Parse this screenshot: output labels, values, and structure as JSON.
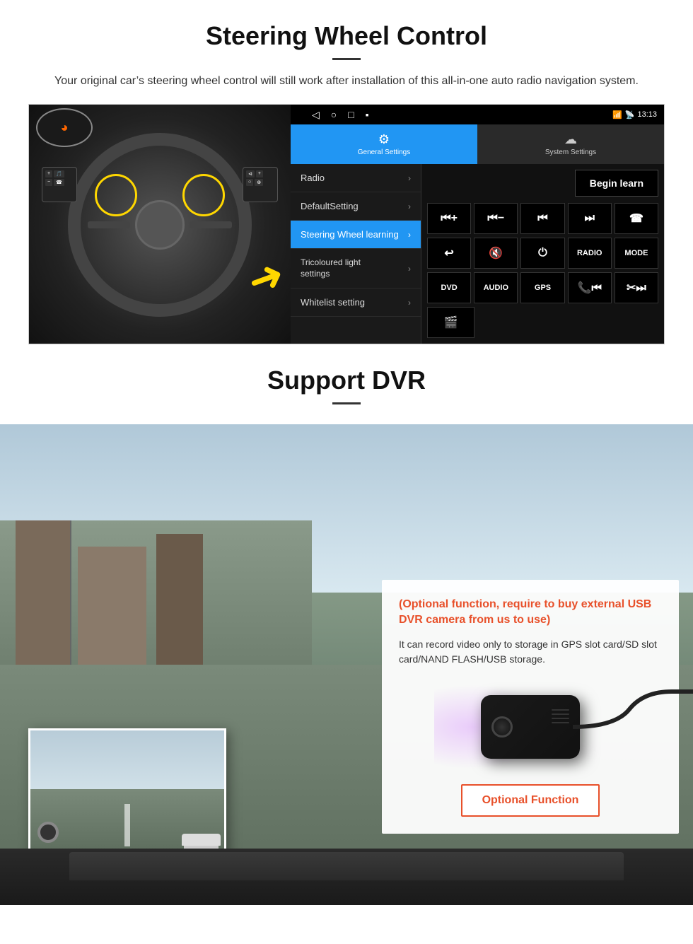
{
  "steering": {
    "title": "Steering Wheel Control",
    "subtitle": "Your original car’s steering wheel control will still work after installation of this all-in-one auto radio navigation system.",
    "android": {
      "statusbar": {
        "time": "13:13",
        "signal_icon": "▼",
        "wifi_icon": "▾",
        "battery_icon": "▪"
      },
      "tabs": [
        {
          "label": "General Settings",
          "icon": "⚙",
          "active": true
        },
        {
          "label": "System Settings",
          "icon": "☁",
          "active": false
        }
      ],
      "navbar": {
        "back": "◁",
        "home": "○",
        "recents": "□",
        "menu": "▪"
      },
      "menu_items": [
        {
          "label": "Radio",
          "highlighted": false
        },
        {
          "label": "DefaultSetting",
          "highlighted": false
        },
        {
          "label": "Steering Wheel learning",
          "highlighted": true
        },
        {
          "label": "Tricoloured light settings",
          "highlighted": false
        },
        {
          "label": "Whitelist setting",
          "highlighted": false
        }
      ],
      "begin_learn_btn": "Begin learn",
      "control_rows": [
        [
          "⏮+",
          "⏮−",
          "⏮",
          "⏭",
          "☎"
        ],
        [
          "↩",
          "🔇",
          "⏻",
          "RADIO",
          "MODE"
        ],
        [
          "DVD",
          "AUDIO",
          "GPS",
          "📞⏮",
          "✂⏭"
        ],
        [
          "🎬"
        ]
      ]
    }
  },
  "dvr": {
    "title": "Support DVR",
    "optional_text": "(Optional function, require to buy external USB DVR camera from us to use)",
    "desc_text": "It can record video only to storage in GPS slot card/SD slot card/NAND FLASH/USB storage.",
    "optional_btn": "Optional Function"
  }
}
